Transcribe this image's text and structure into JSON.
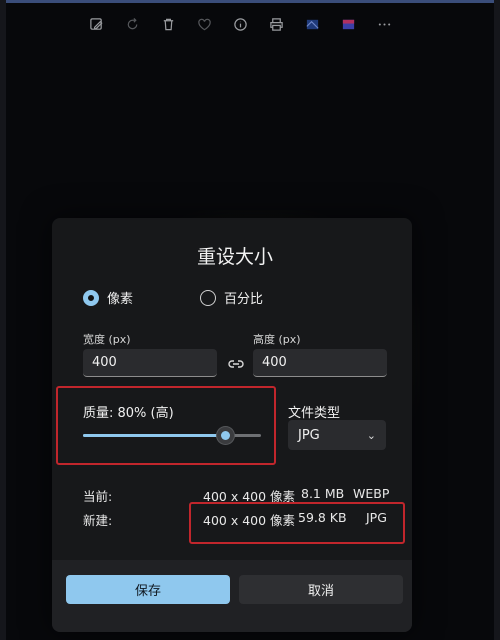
{
  "toolbar": {
    "icons": [
      "edit-image-icon",
      "rotate-icon",
      "delete-icon",
      "favorite-icon",
      "info-icon",
      "print-icon",
      "wallpaper-icon",
      "color-icon",
      "more-icon"
    ]
  },
  "dialog": {
    "title": "重设大小",
    "mode_pixels": "像素",
    "mode_percent": "百分比",
    "selected_mode": "pixels",
    "width_label": "宽度 (px)",
    "width_value": "400",
    "height_label": "高度 (px)",
    "height_value": "400",
    "quality_label": "质量: 80% (高)",
    "quality_value": 80,
    "filetype_label": "文件类型",
    "filetype_value": "JPG",
    "current_label": "当前:",
    "current_size": "400 x 400 像素",
    "current_filesize": "8.1 MB",
    "current_format": "WEBP",
    "new_label": "新建:",
    "new_size": "400 x 400 像素",
    "new_filesize": "59.8 KB",
    "new_format": "JPG",
    "save_label": "保存",
    "cancel_label": "取消"
  },
  "colors": {
    "accent": "#8fc8ee",
    "highlight_box": "#c1262c",
    "dialog_bg": "#17181a"
  }
}
